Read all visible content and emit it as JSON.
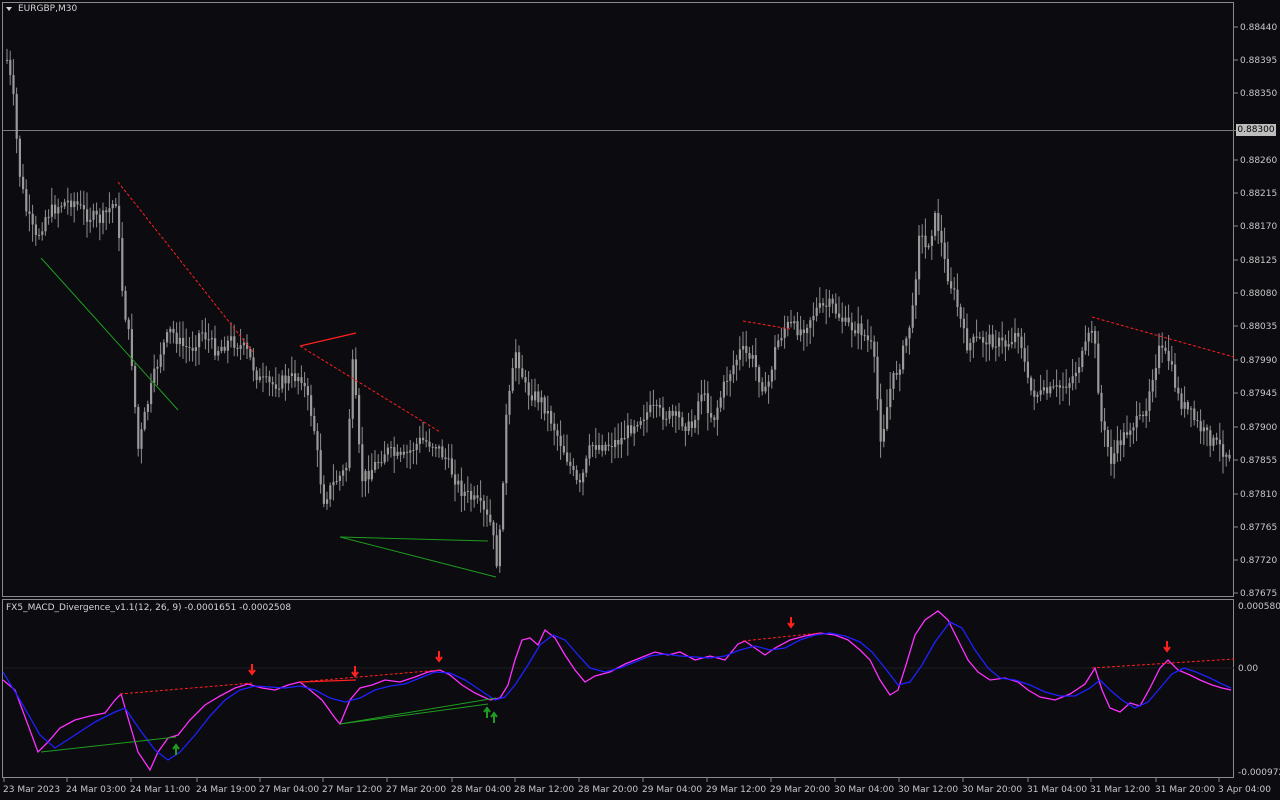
{
  "window": {
    "symbol_title": "EURGBP,M30",
    "current_price_label": "0.88300"
  },
  "price_axis": [
    "0.88440",
    "0.88395",
    "0.88350",
    "0.88260",
    "0.88215",
    "0.88170",
    "0.88125",
    "0.88080",
    "0.88035",
    "0.87990",
    "0.87945",
    "0.87900",
    "0.87855",
    "0.87810",
    "0.87765",
    "0.87720",
    "0.87675"
  ],
  "indicator": {
    "title": "FX5_MACD_Divergence_v1.1(12, 26, 9) -0.0001651 -0.0002508",
    "axis_top": "0.0005807",
    "axis_zero": "0.00",
    "axis_bottom": "-0.000972"
  },
  "time_axis": [
    "23 Mar 2023",
    "24 Mar 03:00",
    "24 Mar 11:00",
    "24 Mar 19:00",
    "27 Mar 04:00",
    "27 Mar 12:00",
    "27 Mar 20:00",
    "28 Mar 04:00",
    "28 Mar 12:00",
    "28 Mar 20:00",
    "29 Mar 04:00",
    "29 Mar 12:00",
    "29 Mar 20:00",
    "30 Mar 04:00",
    "30 Mar 12:00",
    "30 Mar 20:00",
    "31 Mar 04:00",
    "31 Mar 12:00",
    "31 Mar 20:00",
    "3 Apr 04:00"
  ],
  "colors": {
    "background": "#0b0b10",
    "candle": "#9a9a9a",
    "bearish_divergence": "#ff2020",
    "bullish_divergence": "#1f9d1f",
    "macd_line": "#ff30ff",
    "signal_line": "#2020ff",
    "grid_border": "#8a8a8a"
  }
}
